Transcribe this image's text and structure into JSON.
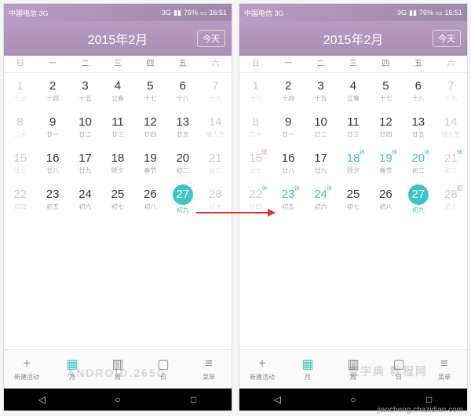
{
  "status": {
    "carrier": "中国电信 3G",
    "signal": "3G",
    "battery": "76%",
    "time": "16:51"
  },
  "header": {
    "title": "2015年2月",
    "today": "今天"
  },
  "weekdays": [
    "日",
    "一",
    "二",
    "三",
    "四",
    "五",
    "六"
  ],
  "weeks_left": [
    [
      {
        "n": "1",
        "s": "十三",
        "dim": true
      },
      {
        "n": "2",
        "s": "十四"
      },
      {
        "n": "3",
        "s": "十五"
      },
      {
        "n": "4",
        "s": "立春"
      },
      {
        "n": "5",
        "s": "十七"
      },
      {
        "n": "6",
        "s": "十八"
      },
      {
        "n": "7",
        "s": "十九",
        "dim": true
      }
    ],
    [
      {
        "n": "8",
        "s": "二十",
        "dim": true
      },
      {
        "n": "9",
        "s": "廿一"
      },
      {
        "n": "10",
        "s": "廿二"
      },
      {
        "n": "11",
        "s": "廿三"
      },
      {
        "n": "12",
        "s": "廿四"
      },
      {
        "n": "13",
        "s": "廿五"
      },
      {
        "n": "14",
        "s": "情人节",
        "dim": true
      }
    ],
    [
      {
        "n": "15",
        "s": "廿七",
        "dim": true
      },
      {
        "n": "16",
        "s": "廿八"
      },
      {
        "n": "17",
        "s": "廿九"
      },
      {
        "n": "18",
        "s": "除夕"
      },
      {
        "n": "19",
        "s": "春节"
      },
      {
        "n": "20",
        "s": "初二"
      },
      {
        "n": "21",
        "s": "初三",
        "dim": true
      }
    ],
    [
      {
        "n": "22",
        "s": "初四",
        "dim": true
      },
      {
        "n": "23",
        "s": "初五"
      },
      {
        "n": "24",
        "s": "初六"
      },
      {
        "n": "25",
        "s": "初七"
      },
      {
        "n": "26",
        "s": "初八"
      },
      {
        "n": "27",
        "s": "初九",
        "today": true
      },
      {
        "n": "28",
        "s": "初十",
        "dim": true
      }
    ]
  ],
  "weeks_right": [
    [
      {
        "n": "1",
        "s": "十三",
        "dim": true
      },
      {
        "n": "2",
        "s": "十四"
      },
      {
        "n": "3",
        "s": "十五"
      },
      {
        "n": "4",
        "s": "立春"
      },
      {
        "n": "5",
        "s": "十七"
      },
      {
        "n": "6",
        "s": "十八"
      },
      {
        "n": "7",
        "s": "十九",
        "dim": true
      }
    ],
    [
      {
        "n": "8",
        "s": "二十",
        "dim": true
      },
      {
        "n": "9",
        "s": "廿一"
      },
      {
        "n": "10",
        "s": "廿二"
      },
      {
        "n": "11",
        "s": "廿三"
      },
      {
        "n": "12",
        "s": "廿四"
      },
      {
        "n": "13",
        "s": "廿五"
      },
      {
        "n": "14",
        "s": "情人节",
        "dim": true
      }
    ],
    [
      {
        "n": "15",
        "s": "廿七",
        "dim": true,
        "tag": "班",
        "tagc": "work"
      },
      {
        "n": "16",
        "s": "廿八"
      },
      {
        "n": "17",
        "s": "廿九"
      },
      {
        "n": "18",
        "s": "除夕",
        "tag": "休",
        "tagc": "rest",
        "hol": true
      },
      {
        "n": "19",
        "s": "春节",
        "tag": "休",
        "tagc": "rest",
        "hol": true
      },
      {
        "n": "20",
        "s": "初二",
        "tag": "休",
        "tagc": "rest",
        "hol": true
      },
      {
        "n": "21",
        "s": "初三",
        "dim": true,
        "tag": "休",
        "tagc": "rest"
      }
    ],
    [
      {
        "n": "22",
        "s": "初四",
        "dim": true,
        "tag": "休",
        "tagc": "rest"
      },
      {
        "n": "23",
        "s": "初五",
        "tag": "休",
        "tagc": "rest",
        "hol": true
      },
      {
        "n": "24",
        "s": "初六",
        "tag": "休",
        "tagc": "rest",
        "hol": true
      },
      {
        "n": "25",
        "s": "初七"
      },
      {
        "n": "26",
        "s": "初八"
      },
      {
        "n": "27",
        "s": "初九",
        "today": true
      },
      {
        "n": "28",
        "s": "初十",
        "dim": true,
        "tag": "班",
        "tagc": "work"
      }
    ]
  ],
  "tabs": [
    {
      "label": "新建活动",
      "icon": "+"
    },
    {
      "label": "月",
      "icon": "▦",
      "active": true
    },
    {
      "label": "周",
      "icon": "▥"
    },
    {
      "label": "日",
      "icon": "▢"
    },
    {
      "label": "菜单",
      "icon": "≡"
    }
  ],
  "watermarks": {
    "left": "ANDROID.265G",
    "right": "查字典 教程网"
  },
  "footer": "jiaocheng.chazidian.com"
}
